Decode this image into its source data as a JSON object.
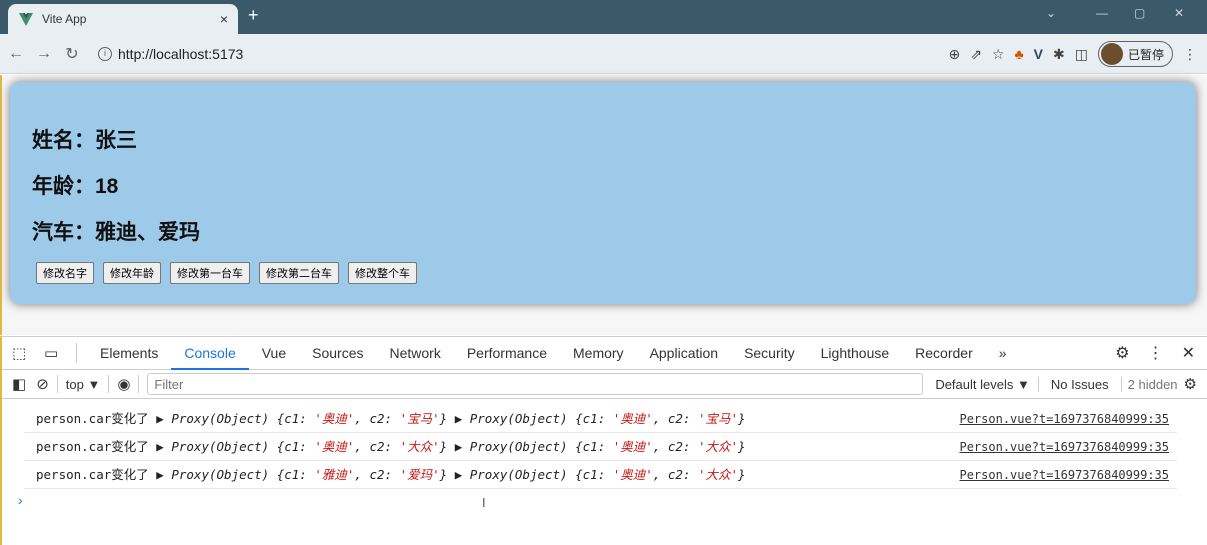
{
  "browser": {
    "tab_title": "Vite App",
    "tab_close": "×",
    "new_tab": "+",
    "url": "http://localhost:5173",
    "profile_status": "已暂停",
    "accent": "#3a5a6a"
  },
  "app": {
    "name_line": "姓名：张三",
    "age_line": "年龄：18",
    "car_line": "汽车：雅迪、爱玛",
    "buttons": [
      "修改名字",
      "修改年龄",
      "修改第一台车",
      "修改第二台车",
      "修改整个车"
    ],
    "card_color": "#9ccae8"
  },
  "devtools": {
    "tabs": [
      "Elements",
      "Console",
      "Vue",
      "Sources",
      "Network",
      "Performance",
      "Memory",
      "Application",
      "Security",
      "Lighthouse",
      "Recorder"
    ],
    "active_tab": "Console",
    "more": "»",
    "context": "top",
    "filter_placeholder": "Filter",
    "levels": "Default levels ▼",
    "issues": "No Issues",
    "hidden": "2 hidden",
    "logs": [
      {
        "prefix": "person.car变化了 ",
        "a1": "'奥迪'",
        "a2": "'宝马'",
        "b1": "'奥迪'",
        "b2": "'宝马'",
        "source": "Person.vue?t=1697376840999:35"
      },
      {
        "prefix": "person.car变化了 ",
        "a1": "'奥迪'",
        "a2": "'大众'",
        "b1": "'奥迪'",
        "b2": "'大众'",
        "source": "Person.vue?t=1697376840999:35"
      },
      {
        "prefix": "person.car变化了 ",
        "a1": "'雅迪'",
        "a2": "'爱玛'",
        "b1": "'奥迪'",
        "b2": "'大众'",
        "source": "Person.vue?t=1697376840999:35"
      }
    ],
    "proxy_label": "▶ Proxy(Object) ",
    "prompt": "›"
  }
}
